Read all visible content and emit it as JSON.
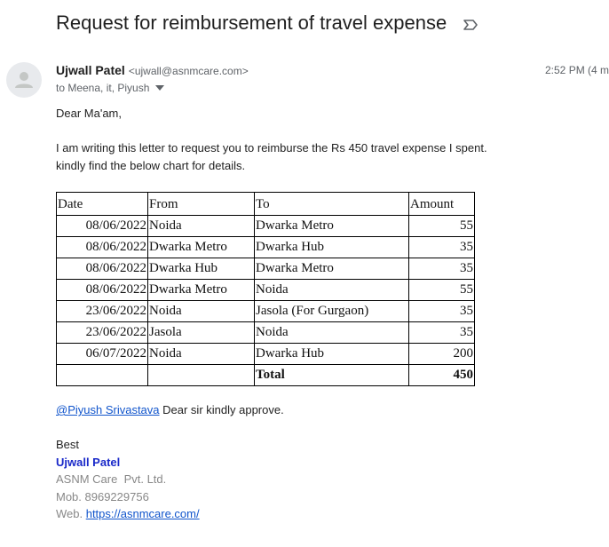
{
  "email": {
    "subject": "Request for reimbursement of travel expense",
    "sender_name": "Ujwall Patel",
    "sender_email": "<ujwall@asnmcare.com>",
    "time": "2:52 PM (4 m",
    "recipients": "to Meena, it, Piyush"
  },
  "body": {
    "greeting": "Dear Ma'am,",
    "line1": "I am writing this letter to request you to reimburse the Rs 450 travel expense I spent.",
    "line2": "kindly find the below chart for details.",
    "mention": "@Piyush Srivastava",
    "approve_text": " Dear sir kindly approve."
  },
  "table": {
    "headers": [
      "Date",
      "From",
      "To",
      "Amount"
    ],
    "rows": [
      [
        "08/06/2022",
        "Noida",
        "Dwarka Metro",
        "55"
      ],
      [
        "08/06/2022",
        "Dwarka Metro",
        "Dwarka Hub",
        "35"
      ],
      [
        "08/06/2022",
        "Dwarka Hub",
        "Dwarka Metro",
        "35"
      ],
      [
        "08/06/2022",
        "Dwarka Metro",
        "Noida",
        "55"
      ],
      [
        "23/06/2022",
        "Noida",
        "Jasola (For Gurgaon)",
        "35"
      ],
      [
        "23/06/2022",
        "Jasola",
        "Noida",
        "35"
      ],
      [
        "06/07/2022",
        "Noida",
        "Dwarka Hub",
        "200"
      ]
    ],
    "total_label": "Total",
    "total_value": "450"
  },
  "signature": {
    "closing": "Best",
    "name": "Ujwall Patel",
    "company": "ASNM Care  Pvt. Ltd.",
    "mobile": "Mob. 8969229756",
    "web_label": "Web. ",
    "web_link": "https://asnmcare.com/"
  },
  "colors": {
    "link": "#1155cc",
    "signature_name": "#1a29c9",
    "muted": "#5f6368"
  },
  "icons": {
    "label": "label-important-icon",
    "avatar": "default-avatar-icon",
    "dropdown": "chevron-down-icon"
  }
}
